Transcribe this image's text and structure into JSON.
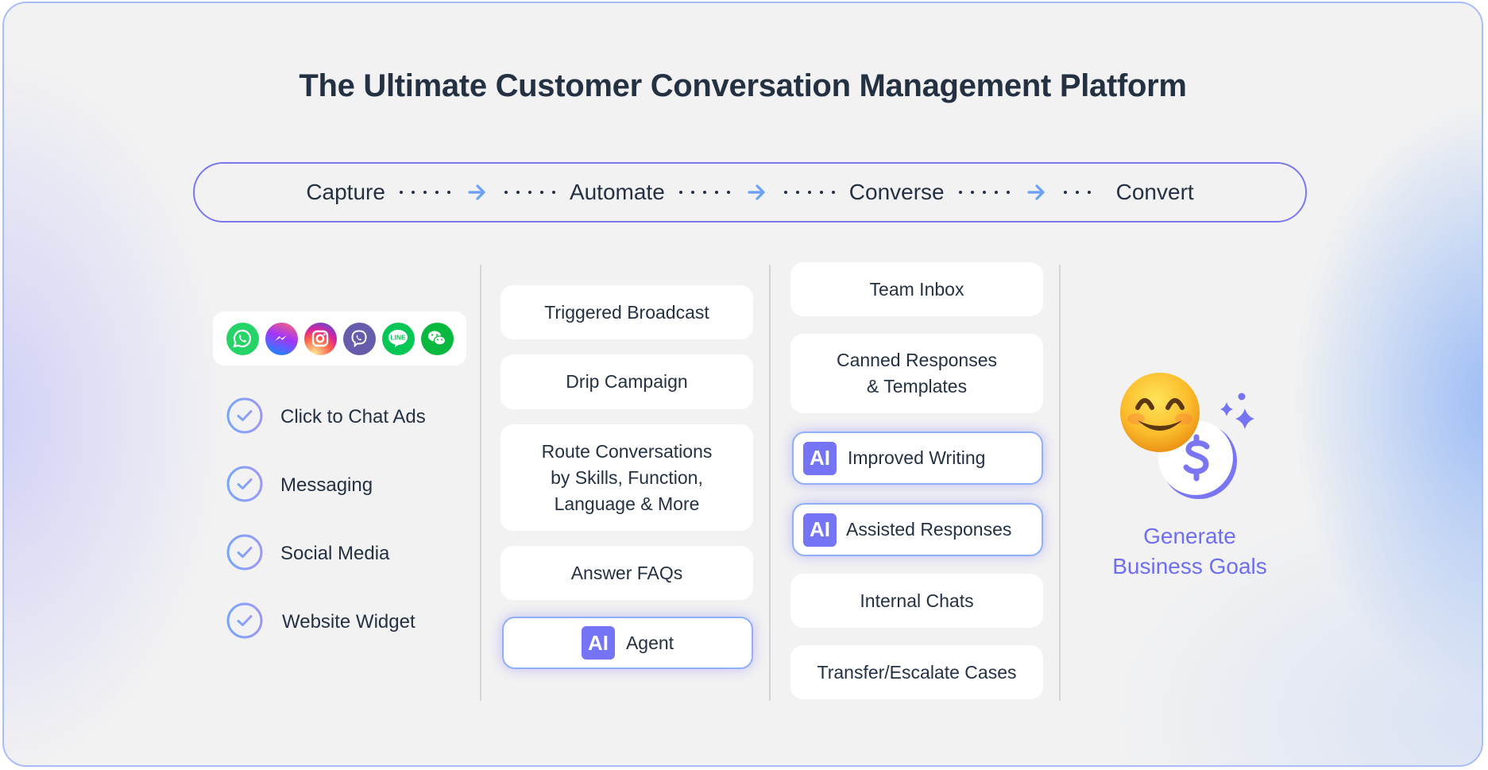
{
  "title": "The Ultimate Customer Conversation Management Platform",
  "pipeline": {
    "stages": [
      "Capture",
      "Automate",
      "Converse",
      "Convert"
    ],
    "separator_icon": "arrow-right-icon"
  },
  "capture": {
    "channels": [
      {
        "name": "WhatsApp",
        "icon": "whatsapp-icon",
        "color": "#25d366"
      },
      {
        "name": "Messenger",
        "icon": "messenger-icon",
        "color": "#a334fa"
      },
      {
        "name": "Instagram",
        "icon": "instagram-icon",
        "color": "#e1306c"
      },
      {
        "name": "Viber",
        "icon": "viber-icon",
        "color": "#665cac"
      },
      {
        "name": "LINE",
        "icon": "line-icon",
        "color": "#06c755",
        "label": "LINE"
      },
      {
        "name": "WeChat",
        "icon": "wechat-icon",
        "color": "#09b83e"
      }
    ],
    "items": [
      "Click to Chat Ads",
      "Messaging",
      "Social Media",
      "Website Widget"
    ]
  },
  "automate": {
    "cards": [
      {
        "label_lines": [
          "Triggered Broadcast"
        ],
        "ai": false
      },
      {
        "label_lines": [
          "Drip Campaign"
        ],
        "ai": false
      },
      {
        "label_lines": [
          "Route Conversations",
          "by Skills, Function,",
          "Language & More"
        ],
        "ai": false
      },
      {
        "label_lines": [
          "Answer FAQs"
        ],
        "ai": false
      },
      {
        "label_lines": [
          "Agent"
        ],
        "ai": true
      }
    ]
  },
  "converse": {
    "cards": [
      {
        "label_lines": [
          "Team Inbox"
        ],
        "ai": false
      },
      {
        "label_lines": [
          "Canned Responses",
          "& Templates"
        ],
        "ai": false
      },
      {
        "label_lines": [
          "Improved Writing"
        ],
        "ai": true
      },
      {
        "label_lines": [
          "Assisted Responses"
        ],
        "ai": true
      },
      {
        "label_lines": [
          "Internal Chats"
        ],
        "ai": false
      },
      {
        "label_lines": [
          "Transfer/Escalate Cases"
        ],
        "ai": false
      }
    ]
  },
  "ai_badge_label": "AI",
  "convert": {
    "emoji": "😊",
    "icons": [
      "smiling-face-icon",
      "dollar-coin-icon",
      "sparkles-icon"
    ],
    "goal_lines": [
      "Generate",
      "Business Goals"
    ]
  },
  "colors": {
    "text": "#243142",
    "accent": "#7474f5",
    "arrow": "#6aa0f7",
    "goal_text": "#6f6ef2",
    "pill_border": "#7b78ee"
  }
}
